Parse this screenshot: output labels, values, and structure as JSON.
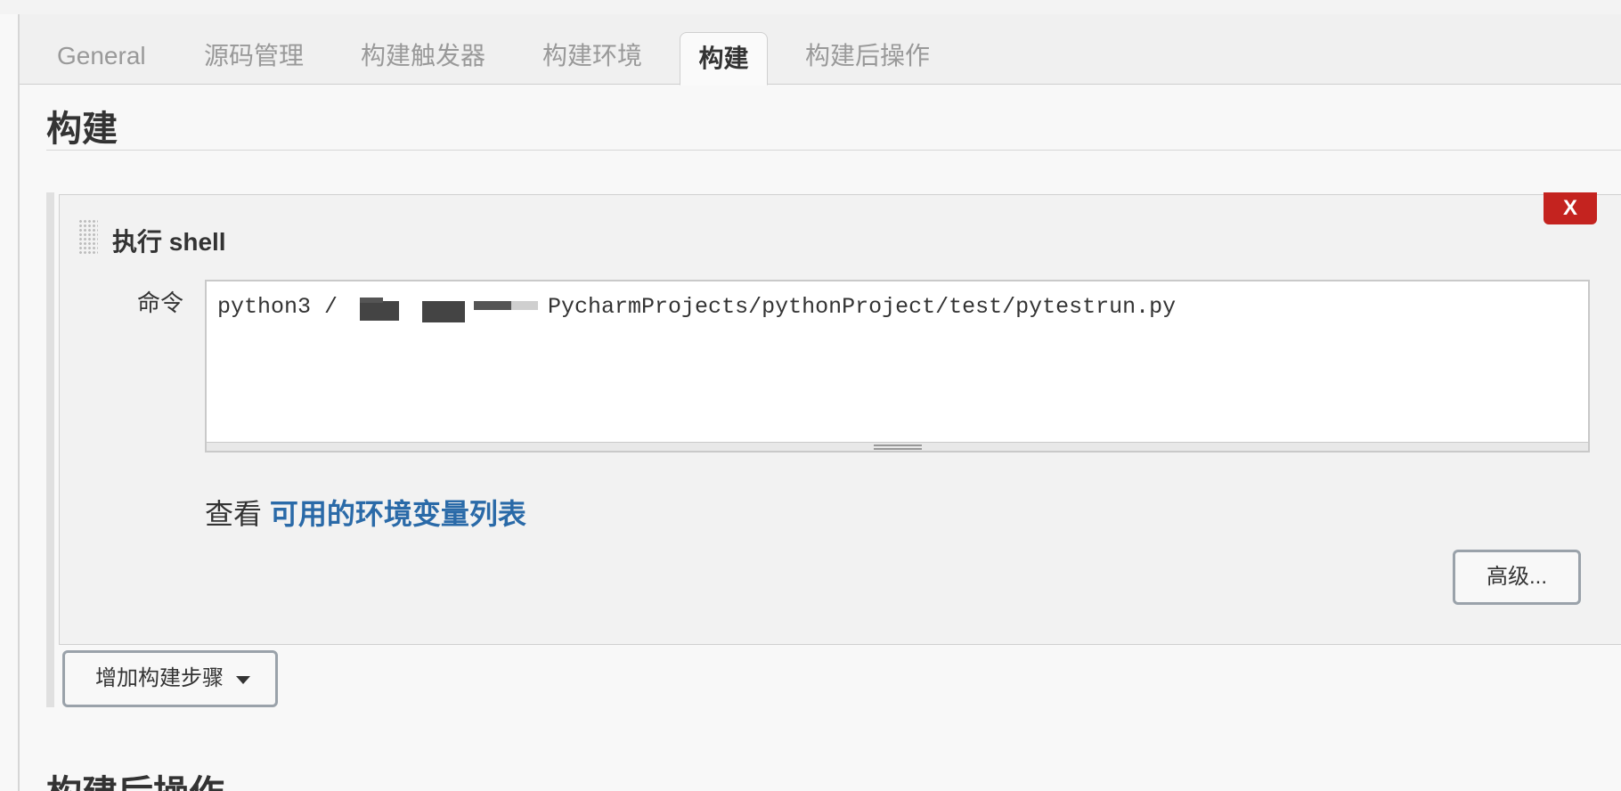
{
  "tabs": [
    {
      "label": "General"
    },
    {
      "label": "源码管理"
    },
    {
      "label": "构建触发器"
    },
    {
      "label": "构建环境"
    },
    {
      "label": "构建",
      "active": true
    },
    {
      "label": "构建后操作"
    }
  ],
  "section": {
    "title": "构建"
  },
  "build_step": {
    "title": "执行 shell",
    "close_label": "X",
    "command_label": "命令",
    "command_prefix": "python3 /",
    "command_suffix": "PycharmProjects/pythonProject/test/pytestrun.py",
    "env_prefix": "查看",
    "env_link": "可用的环境变量列表",
    "advanced_label": "高级..."
  },
  "add_step": {
    "label": "增加构建步骤"
  },
  "next_section": {
    "title": "构建后操作"
  },
  "colors": {
    "close_button": "#c4231f",
    "link": "#2a6aa8",
    "active_tab_text": "#333333",
    "inactive_tab_text": "#999999"
  },
  "icons": [
    "drag-handle-icon",
    "caret-down-icon",
    "resize-grip-icon"
  ]
}
